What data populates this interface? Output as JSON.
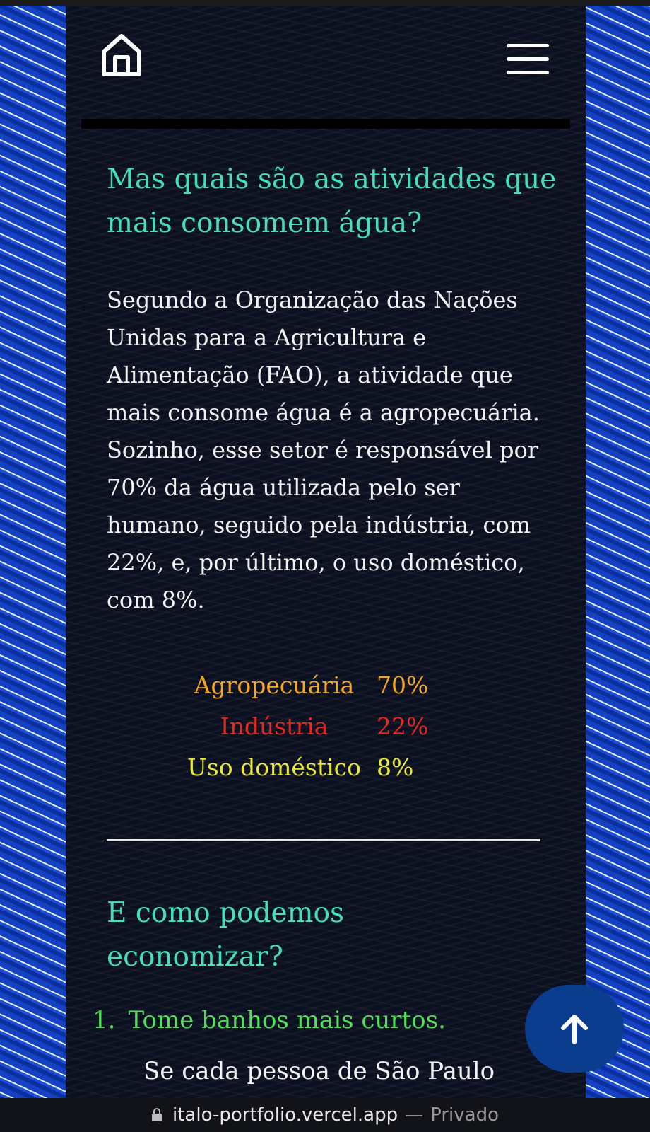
{
  "colors": {
    "accent_heading": "#45e0b8",
    "agropecuaria": "#f5a623",
    "industria": "#e8281f",
    "uso_domestico": "#e9e83a",
    "list_item": "#52e05a",
    "scroll_button": "#0b3d8f"
  },
  "icons": {
    "home": "home-icon",
    "menu": "hamburger-menu-icon",
    "scroll_top": "arrow-up-icon",
    "lock": "lock-icon"
  },
  "section1": {
    "title": "Mas quais são as atividades que mais consomem água?",
    "paragraph": "Segundo a Organização das Nações Unidas para a Agricultura e Alimentação (FAO), a atividade que mais consome água é a agropecuária. Sozinho, esse setor é responsável por 70% da água utilizada pelo ser humano, seguido pela indústria, com 22%, e, por último, o uso doméstico, com 8%.",
    "stats": [
      {
        "label": "Agropecuária",
        "value": "70%"
      },
      {
        "label": "Indústria",
        "value": "22%"
      },
      {
        "label": "Uso doméstico",
        "value": "8%"
      }
    ]
  },
  "section2": {
    "title": "E como podemos economizar?",
    "list": [
      {
        "number": "1.",
        "text": "Tome banhos mais curtos."
      }
    ],
    "cut_text": "Se cada pessoa de São Paulo"
  },
  "browser": {
    "url": "italo-portfolio.vercel.app",
    "separator": "—",
    "mode": "Privado"
  }
}
